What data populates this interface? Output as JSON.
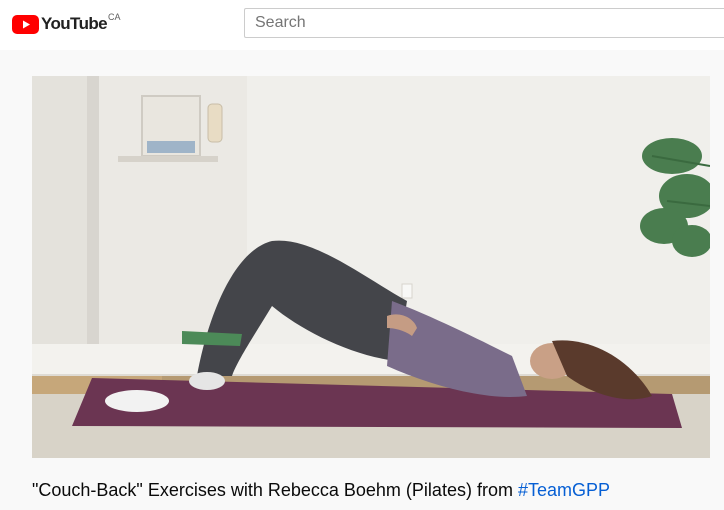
{
  "header": {
    "logo_text": "YouTube",
    "country_code": "CA",
    "search_placeholder": "Search"
  },
  "video": {
    "title_prefix": "\"Couch-Back\" Exercises with Rebecca Boehm (Pilates) from ",
    "hashtag": "#TeamGPP"
  },
  "colors": {
    "brand_red": "#ff0000",
    "link_blue": "#065fd4"
  }
}
